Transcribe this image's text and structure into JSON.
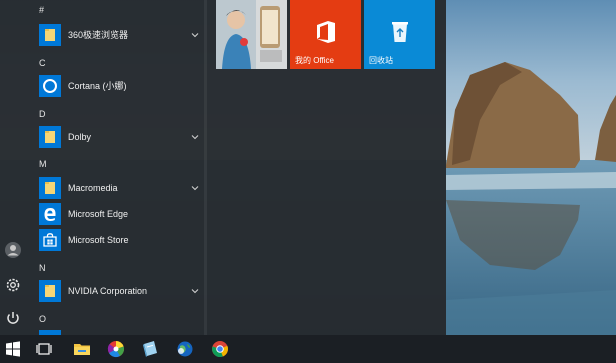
{
  "colors": {
    "accent": "#0078d7",
    "office_tile": "#e43c12",
    "recycle_tile": "#0a8ad6",
    "folder": "#f6d676",
    "menu_bg": "#262a2e"
  },
  "rail": {
    "icons": [
      "user-icon",
      "gear-icon",
      "power-icon"
    ]
  },
  "app_list": {
    "groups": [
      {
        "letter": "#",
        "items": [
          {
            "label": "360极速浏览器",
            "icon": "folder-icon",
            "expandable": true
          }
        ]
      },
      {
        "letter": "C",
        "items": [
          {
            "label": "Cortana (小娜)",
            "icon": "cortana-icon",
            "expandable": false
          }
        ]
      },
      {
        "letter": "D",
        "items": [
          {
            "label": "Dolby",
            "icon": "folder-icon",
            "expandable": true
          }
        ]
      },
      {
        "letter": "M",
        "items": [
          {
            "label": "Macromedia",
            "icon": "folder-icon",
            "expandable": true
          },
          {
            "label": "Microsoft Edge",
            "icon": "edge-icon",
            "expandable": false
          },
          {
            "label": "Microsoft Store",
            "icon": "store-icon",
            "expandable": false
          }
        ]
      },
      {
        "letter": "N",
        "items": [
          {
            "label": "NVIDIA Corporation",
            "icon": "folder-icon",
            "expandable": true
          }
        ]
      },
      {
        "letter": "O",
        "items": []
      }
    ]
  },
  "tiles": [
    {
      "label": "",
      "kind": "photo"
    },
    {
      "label": "我的 Office",
      "kind": "office-icon"
    },
    {
      "label": "回收站",
      "kind": "recycle-bin-icon"
    }
  ],
  "taskbar": {
    "icons": [
      "windows-start-icon",
      "task-view-icon",
      "file-explorer-icon",
      "color-wheel-icon",
      "notebook-app-icon",
      "globe-app-icon",
      "chrome-icon"
    ]
  }
}
